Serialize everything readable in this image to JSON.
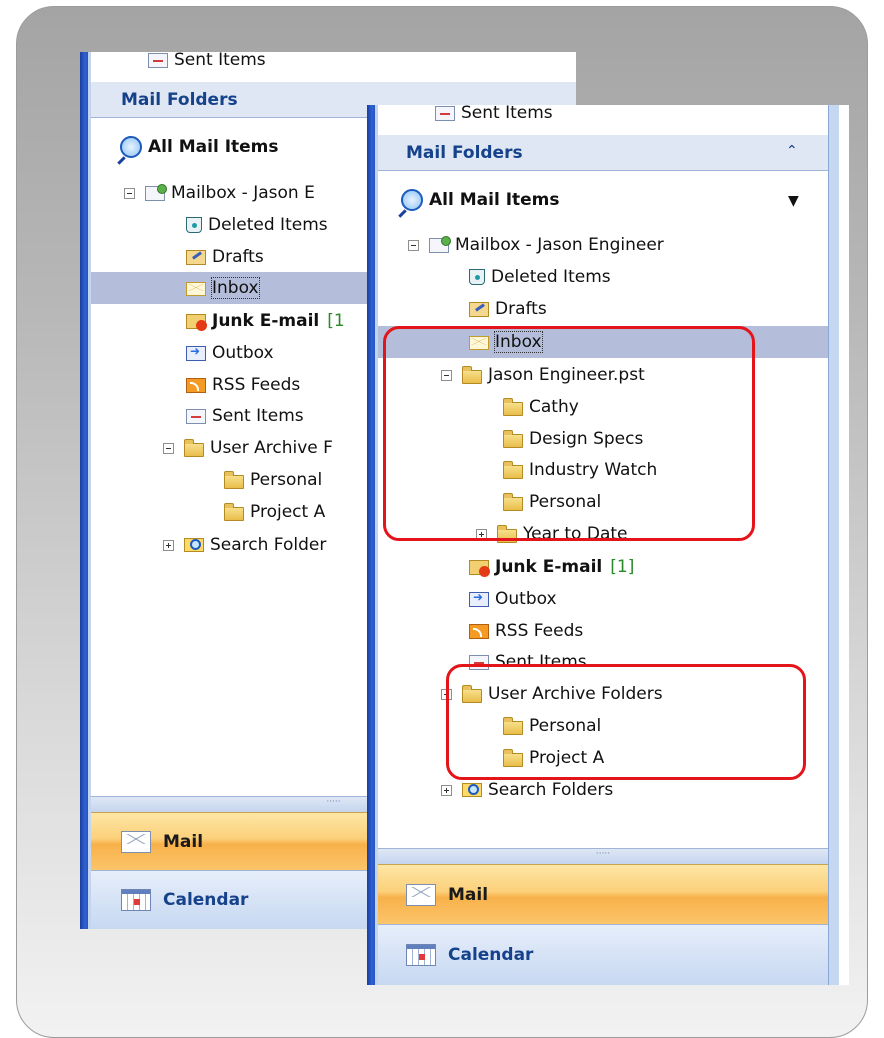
{
  "left_pane": {
    "top_item": "Sent Items",
    "header": "Mail Folders",
    "all_mail": "All Mail Items",
    "mailbox": "Mailbox - Jason E",
    "items": {
      "deleted": "Deleted Items",
      "drafts": "Drafts",
      "inbox": "Inbox",
      "junk": "Junk E-mail",
      "junk_count": "[1",
      "outbox": "Outbox",
      "rss": "RSS Feeds",
      "sent": "Sent Items",
      "archive": "User Archive F",
      "personal": "Personal",
      "project_a": "Project A",
      "search": "Search Folder"
    },
    "grip": "·····",
    "nav_mail": "Mail",
    "nav_calendar": "Calendar"
  },
  "right_pane": {
    "top_item": "Sent Items",
    "header": "Mail Folders",
    "header_chevron": "⌃",
    "all_mail": "All Mail Items",
    "dropdown_arrow": "▼",
    "mailbox": "Mailbox - Jason Engineer",
    "items": {
      "deleted": "Deleted Items",
      "drafts": "Drafts",
      "inbox": "Inbox",
      "pst": "Jason Engineer.pst",
      "cathy": "Cathy",
      "design_specs": "Design Specs",
      "industry_watch": "Industry Watch",
      "personal_pst": "Personal",
      "year_to_date": "Year to Date",
      "junk": "Junk E-mail",
      "junk_count": "[1]",
      "outbox": "Outbox",
      "rss": "RSS Feeds",
      "sent": "Sent Items",
      "archive": "User Archive Folders",
      "personal": "Personal",
      "project_a": "Project A",
      "search": "Search Folders"
    },
    "grip": "·····",
    "nav_mail": "Mail",
    "nav_calendar": "Calendar"
  },
  "colors": {
    "highlight_callout": "#e4151a",
    "selection": "#b4bdd9",
    "header_text": "#15428b",
    "unread_count": "#2a8a2a"
  }
}
